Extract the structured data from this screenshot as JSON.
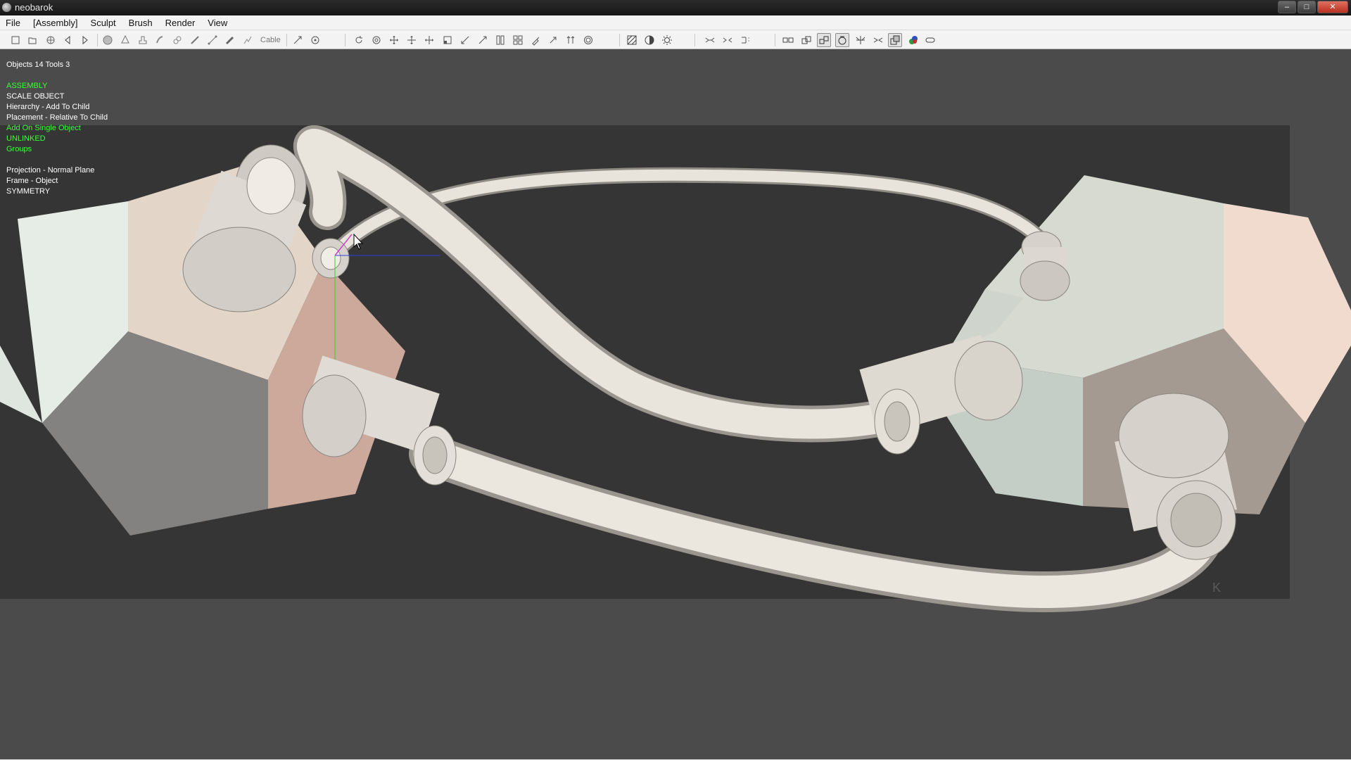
{
  "window": {
    "title": "neobarok",
    "buttons": {
      "minimize": "–",
      "maximize": "□",
      "close": "✕"
    }
  },
  "menu": [
    "File",
    "[Assembly]",
    "Sculpt",
    "Brush",
    "Render",
    "View"
  ],
  "toolbar": {
    "cable_label": "Cable"
  },
  "hud": {
    "objects": "Objects 14  Tools 3",
    "lines_group1": [
      {
        "text": "ASSEMBLY",
        "green": true
      },
      {
        "text": "SCALE OBJECT",
        "green": false
      },
      {
        "text": "Hierarchy - Add To Child",
        "green": false
      },
      {
        "text": "Placement - Relative To Child",
        "green": false
      },
      {
        "text": "Add On Single Object",
        "green": true
      },
      {
        "text": "UNLINKED",
        "green": true
      },
      {
        "text": "Groups",
        "green": true
      }
    ],
    "lines_group2": [
      {
        "text": "Projection - Normal Plane",
        "green": false
      },
      {
        "text": "Frame - Object",
        "green": false
      },
      {
        "text": "SYMMETRY",
        "green": false
      }
    ]
  },
  "viewport": {
    "background": "#4b4b4b",
    "canvas": "#353535",
    "pipe_color": "#e6e2da",
    "corner_mark": "K"
  }
}
